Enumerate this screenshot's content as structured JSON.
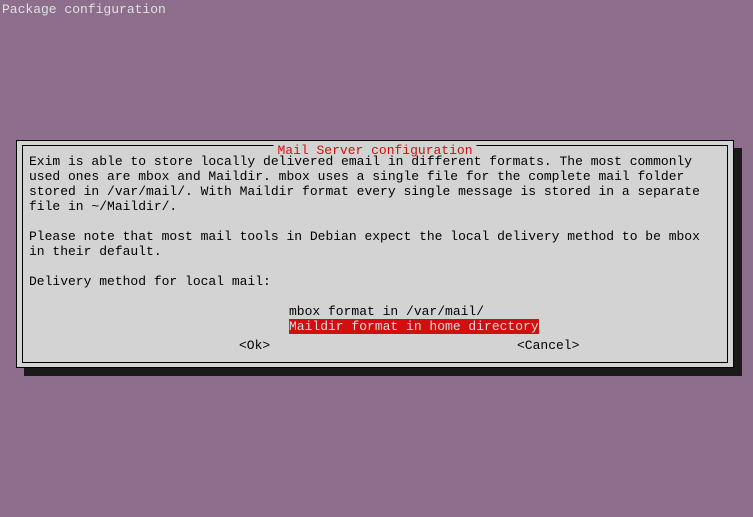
{
  "header": {
    "title": "Package configuration"
  },
  "dialog": {
    "title": " Mail Server configuration ",
    "paragraph1": "Exim is able to store locally delivered email in different formats. The most commonly used ones are mbox and Maildir. mbox uses a single file for the complete mail folder stored in /var/mail/. With Maildir format every single message is stored in a separate file in ~/Maildir/.",
    "paragraph2": "Please note that most mail tools in Debian expect the local delivery method to be mbox in their default.",
    "prompt": "Delivery method for local mail:",
    "options": [
      "mbox format in /var/mail/",
      "Maildir format in home directory"
    ],
    "buttons": {
      "ok": "<Ok>",
      "cancel": "<Cancel>"
    }
  }
}
